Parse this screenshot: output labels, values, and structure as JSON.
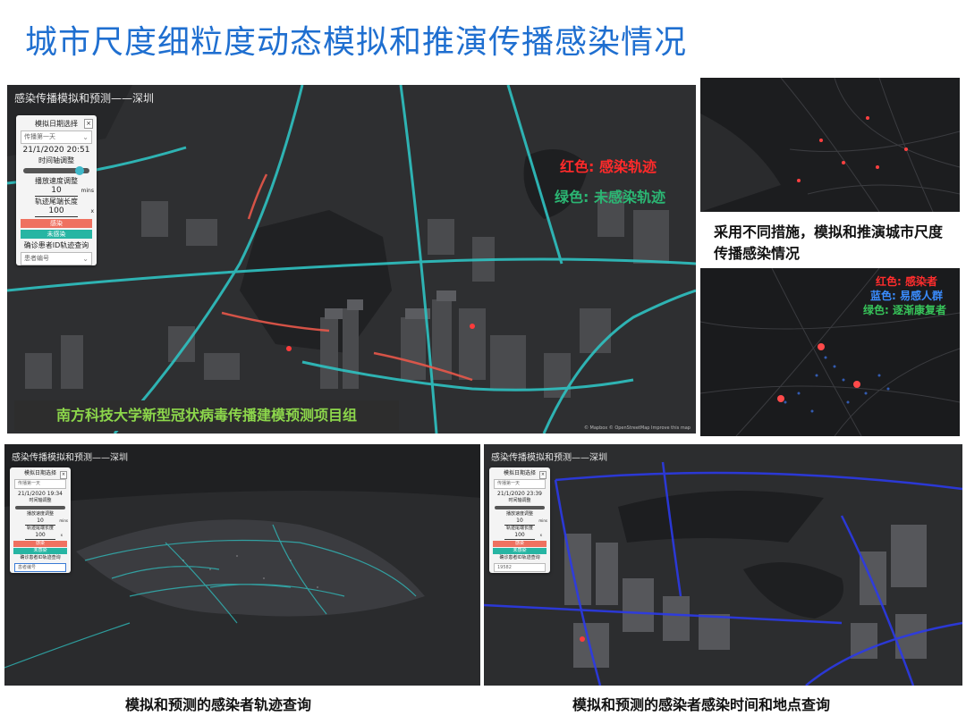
{
  "page_title": "城市尺度细粒度动态模拟和推演传播感染情况",
  "main_panel": {
    "title": "感染传播模拟和预测——深圳",
    "legend_red": "红色: 感染轨迹",
    "legend_green": "绿色: 未感染轨迹",
    "group_label": "南方科技大学新型冠状病毒传播建模预测项目组",
    "attribution": "© Mapbox © OpenStreetMap Improve this map",
    "control": {
      "date_label": "模拟日期选择",
      "date_value": "传播第一天",
      "datetime": "21/1/2020 20:51",
      "time_label": "时间轴调整",
      "speed_label": "播放速度调整",
      "speed_value": "10",
      "speed_unit": "mins",
      "trail_label": "轨迹尾端长度",
      "trail_value": "100",
      "trail_unit": "x",
      "btn_infected": "感染",
      "btn_uninfected": "未感染",
      "query_label": "确诊患者ID轨迹查询",
      "query_placeholder": "患者编号"
    }
  },
  "right_top": {
    "caption": "采用不同措施，模拟和推演城市尺度传播感染情况"
  },
  "right_bottom": {
    "legend": [
      "红色: 感染者",
      "蓝色: 易感人群",
      "绿色: 逐渐康复者"
    ]
  },
  "bottom_left": {
    "title": "感染传播模拟和预测——深圳",
    "caption": "模拟和预测的感染者轨迹查询",
    "control": {
      "date_label": "模拟日期选择",
      "date_value": "传播第一天",
      "datetime": "21/1/2020 19:34",
      "time_label": "时间轴调整",
      "speed_label": "播放速度调整",
      "speed_value": "10",
      "speed_unit": "mins",
      "trail_label": "轨迹尾端长度",
      "trail_value": "100",
      "trail_unit": "x",
      "btn_infected": "感染",
      "btn_uninfected": "未感染",
      "query_label": "确诊患者ID轨迹查询",
      "query_placeholder": "患者编号"
    }
  },
  "bottom_right": {
    "title": "感染传播模拟和预测——深圳",
    "caption": "模拟和预测的感染者感染时间和地点查询",
    "control": {
      "date_label": "模拟日期选择",
      "date_value": "传播第一天",
      "datetime": "21/1/2020 23:39",
      "time_label": "时间轴调整",
      "speed_label": "播放速度调整",
      "speed_value": "10",
      "speed_unit": "mins",
      "trail_label": "轨迹尾端长度",
      "trail_value": "100",
      "trail_unit": "x",
      "btn_infected": "感染",
      "btn_uninfected": "未感染",
      "query_label": "确诊患者ID轨迹查询",
      "query_placeholder": "19582"
    }
  },
  "colors": {
    "title_blue": "#1f6fd0",
    "trail_teal": "#2fc2c2",
    "trail_red": "#e8584a",
    "trail_blue": "#2b3ae8",
    "map_dark": "#2c2c2e",
    "group_green": "#8cd64b"
  }
}
